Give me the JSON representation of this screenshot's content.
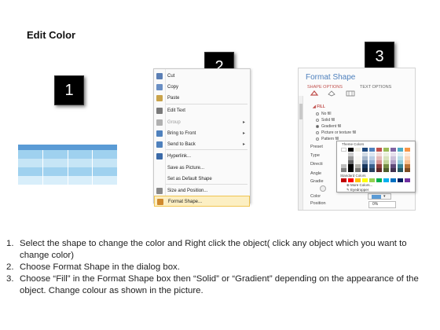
{
  "title": "Edit Color",
  "badges": {
    "step1": "1",
    "step2": "2",
    "step3": "3"
  },
  "context_menu": {
    "items": [
      {
        "label": "Cut",
        "icon": "scissors-icon",
        "submenu": false,
        "disabled": false,
        "highlighted": false
      },
      {
        "label": "Copy",
        "icon": "copy-icon",
        "submenu": false,
        "disabled": false,
        "highlighted": false
      },
      {
        "label": "Paste",
        "icon": "paste-icon",
        "submenu": false,
        "disabled": false,
        "highlighted": false
      },
      {
        "label": "Edit Text",
        "icon": "edit-text-icon",
        "submenu": false,
        "disabled": false,
        "highlighted": false
      },
      {
        "label": "Group",
        "icon": "group-icon",
        "submenu": true,
        "disabled": true,
        "highlighted": false
      },
      {
        "label": "Bring to Front",
        "icon": "bring-front-icon",
        "submenu": true,
        "disabled": false,
        "highlighted": false
      },
      {
        "label": "Send to Back",
        "icon": "send-back-icon",
        "submenu": true,
        "disabled": false,
        "highlighted": false
      },
      {
        "label": "Hyperlink...",
        "icon": "hyperlink-icon",
        "submenu": false,
        "disabled": false,
        "highlighted": false
      },
      {
        "label": "Save as Picture...",
        "icon": "",
        "submenu": false,
        "disabled": false,
        "highlighted": false
      },
      {
        "label": "Set as Default Shape",
        "icon": "",
        "submenu": false,
        "disabled": false,
        "highlighted": false
      },
      {
        "label": "Size and Position...",
        "icon": "size-position-icon",
        "submenu": false,
        "disabled": false,
        "highlighted": false
      },
      {
        "label": "Format Shape...",
        "icon": "format-shape-icon",
        "submenu": false,
        "disabled": false,
        "highlighted": true
      }
    ]
  },
  "format_pane": {
    "title": "Format Shape",
    "tabs": [
      "SHAPE OPTIONS",
      "TEXT OPTIONS"
    ],
    "section": "FILL",
    "options": [
      {
        "label": "No fill",
        "selected": false
      },
      {
        "label": "Solid fill",
        "selected": false
      },
      {
        "label": "Gradient fill",
        "selected": true
      },
      {
        "label": "Picture or texture fill",
        "selected": false
      },
      {
        "label": "Pattern fill",
        "selected": false
      }
    ],
    "field_labels": [
      "Preset",
      "Type",
      "Directi",
      "Angle",
      "Gradie",
      "Color",
      "Position"
    ],
    "position_value": "0%",
    "color_accent": "#5a9bd5"
  },
  "palette": {
    "theme_label": "Theme Colors",
    "standard_label": "Standard Colors",
    "more_colors": "More Colors...",
    "eyedropper": "Eyedropper",
    "theme_columns": [
      "#ffffff",
      "#000000",
      "#eeece1",
      "#1f497d",
      "#4f81bd",
      "#c0504d",
      "#9bbb59",
      "#8064a2",
      "#4bacc6",
      "#f79646"
    ],
    "standard_colors": [
      "#c00000",
      "#ff0000",
      "#ffc000",
      "#ffff00",
      "#92d050",
      "#00b050",
      "#00b0f0",
      "#0070c0",
      "#002060",
      "#7030a0"
    ]
  },
  "instructions": [
    {
      "num": "1.",
      "text": "Select the shape to change the color and Right click the object( click any object which you want to change color)"
    },
    {
      "num": "2.",
      "text": "Choose Format Shape in the dialog box."
    },
    {
      "num": "3.",
      "text": "Choose “Fill” in the Format Shape box then “Solid” or “Gradient” depending on the appearance of the object. Change colour as shown in the picture."
    }
  ]
}
